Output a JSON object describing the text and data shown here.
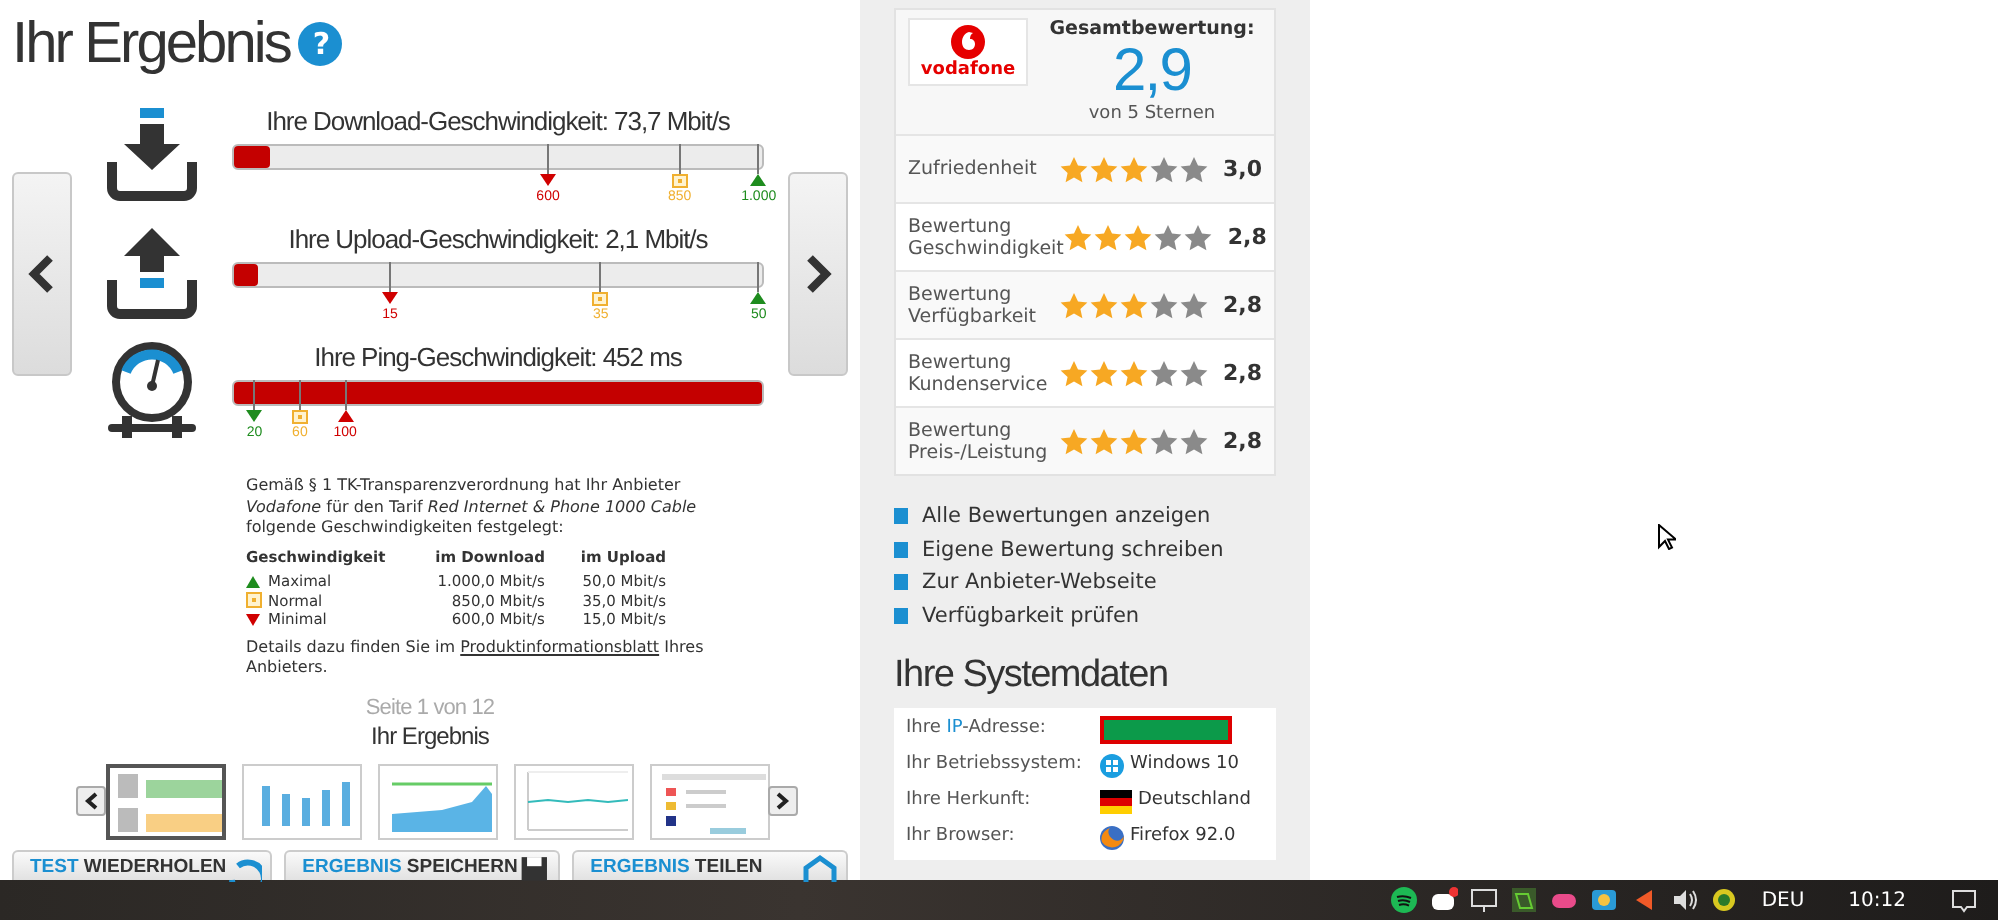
{
  "header": {
    "title": "Ihr Ergebnis",
    "help": "?"
  },
  "speed_tests": [
    {
      "kind": "download",
      "label": "Ihre Download-Geschwindigkeit: 73,7 Mbit/s",
      "level": 0.07,
      "markers": [
        {
          "label": "600",
          "kind": "bad"
        },
        {
          "label": "850",
          "kind": "normal"
        },
        {
          "label": "1.000",
          "kind": "good"
        }
      ]
    },
    {
      "kind": "upload",
      "label": "Ihre Upload-Geschwindigkeit: 2,1 Mbit/s",
      "level": 0.045,
      "markers": [
        {
          "label": "15",
          "kind": "bad"
        },
        {
          "label": "35",
          "kind": "normal"
        },
        {
          "label": "50",
          "kind": "good"
        }
      ]
    },
    {
      "kind": "ping",
      "label": "Ihre Ping-Geschwindigkeit: 452 ms",
      "level": 1.0,
      "markers": [
        {
          "label": "20",
          "kind": "good"
        },
        {
          "label": "60",
          "kind": "normal"
        },
        {
          "label": "100",
          "kind": "bad"
        }
      ]
    }
  ],
  "contract": {
    "text": "Gemäß § 1 TK-Transparenzverordnung hat Ihr Anbieter *Vodafone* für den Tarif *Red Internet & Phone 1000 Cable* folgende Geschwindigkeiten festgelegt:",
    "columns": [
      "Geschwindigkeit",
      "im Download",
      "im Upload"
    ],
    "rows": [
      {
        "kind": "good",
        "label": "Maximal",
        "download": "1.000,0 Mbit/s",
        "upload": "50,0 Mbit/s"
      },
      {
        "kind": "normal",
        "label": "Normal",
        "download": "850,0 Mbit/s",
        "upload": "35,0 Mbit/s"
      },
      {
        "kind": "bad",
        "label": "Minimal",
        "download": "600,0 Mbit/s",
        "upload": "15,0 Mbit/s"
      }
    ],
    "details": {
      "before": "Details dazu finden Sie im ",
      "link": "Produktinformationsblatt",
      "after": " Ihres Anbieters."
    }
  },
  "pager": {
    "page": "Seite 1 von 12",
    "title": "Ihr Ergebnis"
  },
  "thumbnails": [
    {
      "kind": "speed",
      "selected": true
    },
    {
      "kind": "bars",
      "selected": false
    },
    {
      "kind": "area",
      "selected": false
    },
    {
      "kind": "line",
      "selected": false
    },
    {
      "kind": "table",
      "selected": false
    }
  ],
  "actions": [
    {
      "kind": "repeat",
      "accent": "TEST",
      "label": "WIEDERHOLEN"
    },
    {
      "kind": "save",
      "accent": "ERGEBNIS",
      "label": "SPEICHERN"
    },
    {
      "kind": "share",
      "accent": "ERGEBNIS",
      "label": "TEILEN"
    }
  ],
  "provider": {
    "logo_text": "vodafone",
    "overall_label": "Gesamtbewertung:",
    "score": "2,9",
    "scale": "von 5 Sternen"
  },
  "ratings": [
    {
      "label": "Zufriedenheit",
      "stars": 3,
      "value": "3,0"
    },
    {
      "label": "Bewertung Geschwindigkeit",
      "stars": 3,
      "value": "2,8"
    },
    {
      "label": "Bewertung Verfügbarkeit",
      "stars": 3,
      "value": "2,8"
    },
    {
      "label": "Bewertung Kundenservice",
      "stars": 3,
      "value": "2,8"
    },
    {
      "label": "Bewertung Preis-/Leistung",
      "stars": 3,
      "value": "2,8"
    }
  ],
  "links": [
    "Alle Bewertungen anzeigen",
    "Eigene Bewertung schreiben",
    "Zur Anbieter-Webseite",
    "Verfügbarkeit prüfen"
  ],
  "system": {
    "title": "Ihre Systemdaten",
    "rows": [
      {
        "kind": "ip",
        "label": "Ihre ",
        "link": "IP",
        "label_end": "-Adresse:"
      },
      {
        "kind": "os",
        "label": "Ihr Betriebssystem:",
        "value": "Windows 10"
      },
      {
        "kind": "country",
        "label": "Ihre Herkunft:",
        "value": "Deutschland"
      },
      {
        "kind": "browser",
        "label": "Ihr Browser:",
        "value": "Firefox 92.0"
      }
    ]
  },
  "taskbar": {
    "language": "DEU",
    "time": "10:12"
  }
}
